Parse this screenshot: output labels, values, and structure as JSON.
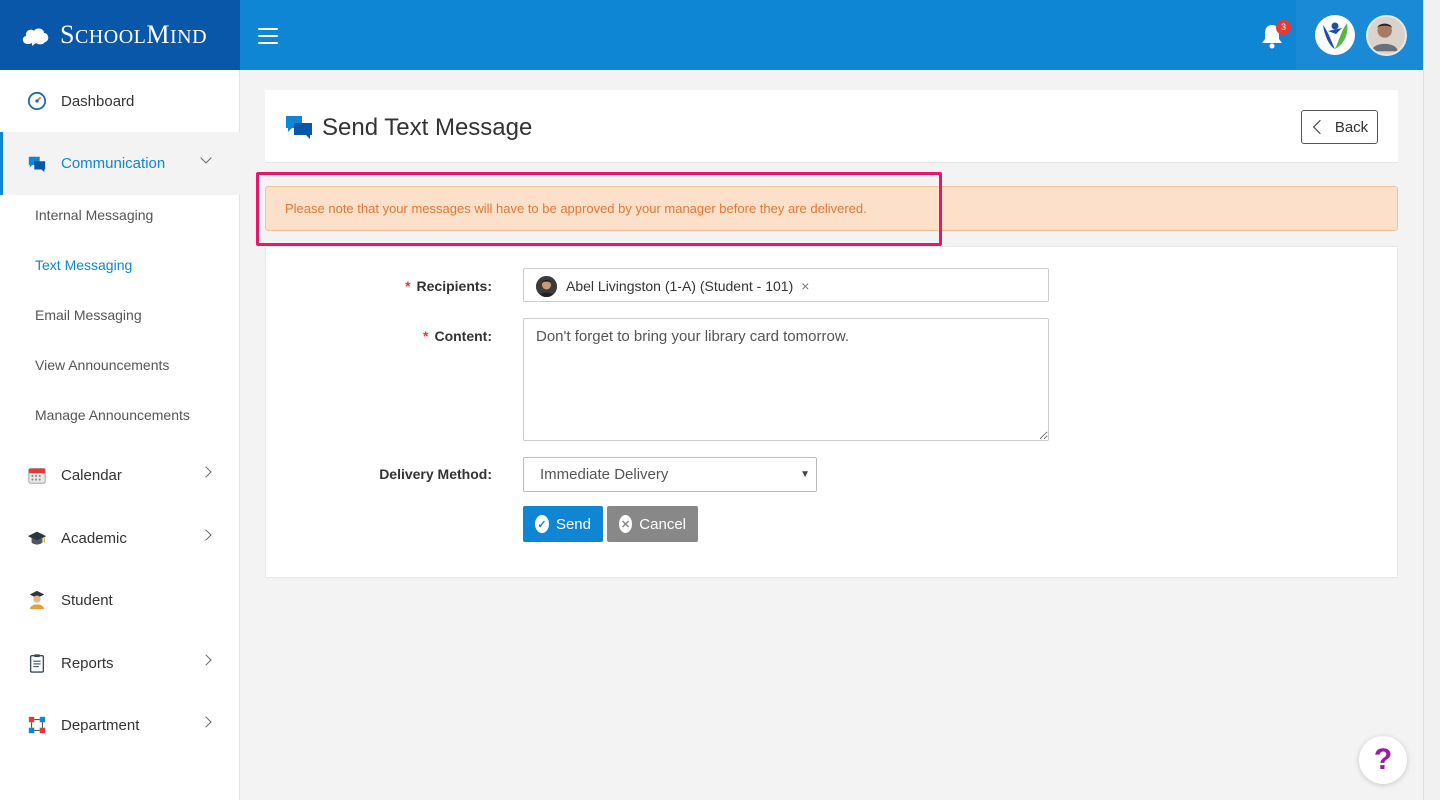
{
  "brand": {
    "name_big": "S",
    "name_rest": "CHOOL",
    "name_big2": "M",
    "name_rest2": "IND"
  },
  "header": {
    "notification_count": "3"
  },
  "sidebar": {
    "dashboard": "Dashboard",
    "communication": "Communication",
    "sub_items": [
      "Internal Messaging",
      "Text Messaging",
      "Email Messaging",
      "View Announcements",
      "Manage Announcements"
    ],
    "calendar": "Calendar",
    "academic": "Academic",
    "student": "Student",
    "reports": "Reports",
    "department": "Department"
  },
  "page": {
    "title": "Send Text Message",
    "back_label": "Back"
  },
  "alert": {
    "text": "Please note that your messages will have to be approved by your manager before they are delivered."
  },
  "form": {
    "recipients_label": "Recipients:",
    "recipient_chip": "Abel Livingston (1-A) (Student - 101)",
    "chip_remove": "×",
    "content_label": "Content:",
    "content_value": "Don't forget to bring your library card tomorrow.",
    "delivery_label": "Delivery Method:",
    "delivery_value": "Immediate Delivery",
    "send_label": "Send",
    "cancel_label": "Cancel",
    "required_mark": "*"
  },
  "help": {
    "label": "?"
  },
  "colors": {
    "primary": "#0e86d4",
    "brand_dark": "#0957a8",
    "alert_bg": "#fde0c9",
    "alert_text": "#e0783a",
    "highlight": "#e5186b"
  }
}
